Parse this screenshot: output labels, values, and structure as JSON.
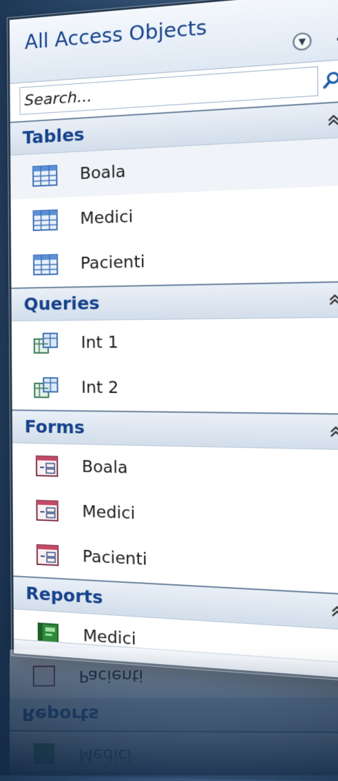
{
  "nav_pane": {
    "title": "All Access Objects",
    "menu_icon": "chevron-down-circle-icon",
    "shutter_icon": "double-chevron-left-icon",
    "search": {
      "placeholder": "Search...",
      "icon": "search-icon"
    }
  },
  "groups": [
    {
      "label": "Tables",
      "icon": "table-icon",
      "items": [
        {
          "name": "Boala"
        },
        {
          "name": "Medici"
        },
        {
          "name": "Pacienti"
        }
      ]
    },
    {
      "label": "Queries",
      "icon": "query-icon",
      "items": [
        {
          "name": "Int 1"
        },
        {
          "name": "Int 2"
        }
      ]
    },
    {
      "label": "Forms",
      "icon": "form-icon",
      "items": [
        {
          "name": "Boala"
        },
        {
          "name": "Medici"
        },
        {
          "name": "Pacienti"
        }
      ]
    },
    {
      "label": "Reports",
      "icon": "report-icon",
      "items": [
        {
          "name": "Medici"
        }
      ]
    }
  ],
  "colors": {
    "header_text": "#15428b",
    "background": "#2c4a6d",
    "pane": "#ffffff"
  }
}
